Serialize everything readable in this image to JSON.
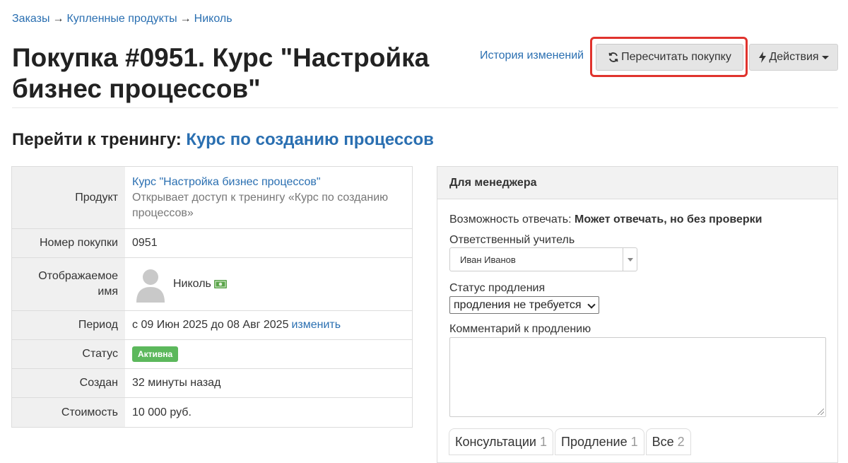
{
  "breadcrumb": {
    "items": [
      "Заказы",
      "Купленные продукты",
      "Николь"
    ],
    "separator": "→"
  },
  "page": {
    "title": "Покупка #0951. Курс \"Настройка бизнес процессов\""
  },
  "header_actions": {
    "history_link": "История изменений",
    "recalc_button": "Пересчитать покупку",
    "actions_button": "Действия"
  },
  "training": {
    "prefix": "Перейти к тренингу:",
    "link": "Курс по созданию процессов"
  },
  "info": {
    "product_label": "Продукт",
    "product_link": "Курс \"Настройка бизнес процессов\"",
    "product_desc": "Открывает доступ к тренингу «Курс по созданию процессов»",
    "number_label": "Номер покупки",
    "number_value": "0951",
    "name_label": "Отображаемое имя",
    "name_value": "Николь",
    "period_label": "Период",
    "period_value": "с 09 Июн 2025 до 08 Авг 2025",
    "period_change": "изменить",
    "status_label": "Статус",
    "status_value": "Активна",
    "created_label": "Создан",
    "created_value": "32 минуты назад",
    "cost_label": "Стоимость",
    "cost_value": "10 000 руб."
  },
  "manager": {
    "header": "Для менеджера",
    "reply_label": "Возможность отвечать:",
    "reply_value": "Может отвечать, но без проверки",
    "teacher_label": "Ответственный учитель",
    "teacher_value": "Иван Иванов",
    "renewal_label": "Статус продления",
    "renewal_value": "продления не требуется",
    "comment_label": "Комментарий к продлению",
    "comment_value": ""
  },
  "tabs": [
    {
      "label": "Консультации",
      "count": "1"
    },
    {
      "label": "Продление",
      "count": "1"
    },
    {
      "label": "Все",
      "count": "2"
    }
  ],
  "colors": {
    "link": "#2a6fb1",
    "highlight_border": "#e0332d",
    "status_badge": "#5cb85c"
  }
}
